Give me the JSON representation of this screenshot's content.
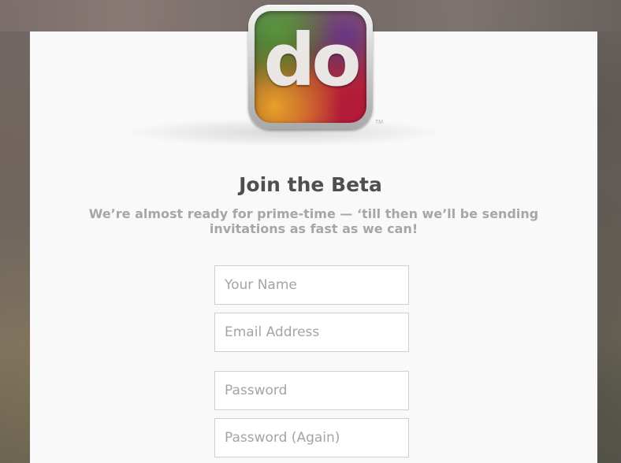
{
  "logo": {
    "wordmark": "do",
    "trademark": "TM",
    "colors": [
      "#4a8a2c",
      "#5b2a7e",
      "#e8a02a",
      "#b31838"
    ]
  },
  "heading": "Join the Beta",
  "subheading": "We’re almost ready for prime-time — ‘till then we’ll be sending invitations as fast as we can!",
  "form": {
    "name": {
      "value": "",
      "placeholder": "Your Name"
    },
    "email": {
      "value": "",
      "placeholder": "Email Address"
    },
    "password": {
      "value": "",
      "placeholder": "Password"
    },
    "password_again": {
      "value": "",
      "placeholder": "Password (Again)"
    }
  }
}
